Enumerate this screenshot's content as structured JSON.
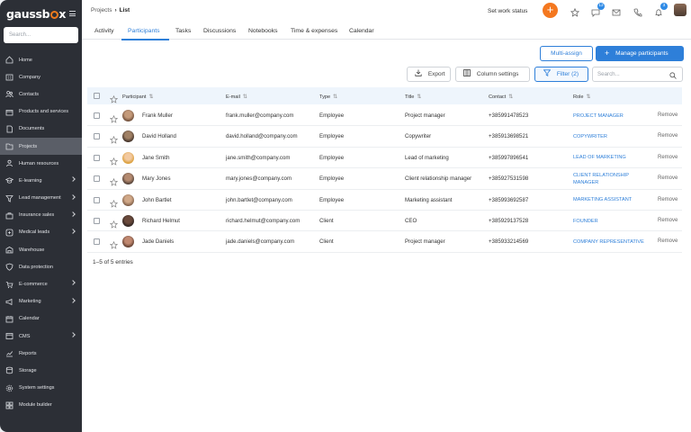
{
  "app": {
    "logo": "gaussbox"
  },
  "sidebar": {
    "search_placeholder": "Search...",
    "items": [
      {
        "label": "Home",
        "icon": "home-icon"
      },
      {
        "label": "Company",
        "icon": "building-icon"
      },
      {
        "label": "Contacts",
        "icon": "contacts-icon"
      },
      {
        "label": "Products and services",
        "icon": "box-icon"
      },
      {
        "label": "Documents",
        "icon": "document-icon"
      },
      {
        "label": "Projects",
        "icon": "folder-icon"
      },
      {
        "label": "Human resources",
        "icon": "people-icon"
      },
      {
        "label": "E-learning",
        "icon": "graduation-icon"
      },
      {
        "label": "Lead management",
        "icon": "funnel-icon"
      },
      {
        "label": "Insurance sales",
        "icon": "briefcase-icon"
      },
      {
        "label": "Medical leads",
        "icon": "medical-icon"
      },
      {
        "label": "Warehouse",
        "icon": "warehouse-icon"
      },
      {
        "label": "Data protection",
        "icon": "shield-icon"
      },
      {
        "label": "E-commerce",
        "icon": "cart-icon"
      },
      {
        "label": "Marketing",
        "icon": "megaphone-icon"
      },
      {
        "label": "Calendar",
        "icon": "calendar-icon"
      },
      {
        "label": "CMS",
        "icon": "cms-icon"
      },
      {
        "label": "Reports",
        "icon": "chart-icon"
      },
      {
        "label": "Storage",
        "icon": "storage-icon"
      },
      {
        "label": "System settings",
        "icon": "gear-icon"
      },
      {
        "label": "Module builder",
        "icon": "module-icon"
      }
    ]
  },
  "header": {
    "breadcrumb_parent": "Projects",
    "breadcrumb_current": "List",
    "set_status": "Set work status",
    "chat_badge": "12",
    "notif_badge": "3"
  },
  "tabs": [
    "Activity",
    "Participants",
    "Tasks",
    "Discussions",
    "Notebooks",
    "Time & expenses",
    "Calendar"
  ],
  "actions": {
    "multi_assign": "Multi-assign",
    "manage": "Manage participants",
    "export": "Export",
    "column_settings": "Column settings",
    "filter": "Filter (2)",
    "search_placeholder": "Search..."
  },
  "table": {
    "columns": [
      "Participant",
      "E-mail",
      "Type",
      "Title",
      "Contact",
      "Role"
    ],
    "rows": [
      {
        "name": "Frank Muller",
        "email": "frank.muller@company.com",
        "type": "Employee",
        "title": "Project manager",
        "contact": "+385991478523",
        "role": "PROJECT MANAGER",
        "action": "Remove"
      },
      {
        "name": "David Holland",
        "email": "david.holland@company.com",
        "type": "Employee",
        "title": "Copywriter",
        "contact": "+385913698521",
        "role": "COPYWRITER",
        "action": "Remove"
      },
      {
        "name": "Jane Smith",
        "email": "jane.smith@company.com",
        "type": "Employee",
        "title": "Lead of marketing",
        "contact": "+385997896541",
        "role": "LEAD OF MARKETING",
        "action": "Remove"
      },
      {
        "name": "Mary Jones",
        "email": "mary.jones@company.com",
        "type": "Employee",
        "title": "Client relationship manager",
        "contact": "+385927531598",
        "role_line1": "CLIENT RELATIONSHIP",
        "role_line2": "MANAGER",
        "action": "Remove"
      },
      {
        "name": "John Bartlet",
        "email": "john.bartlet@company.com",
        "type": "Employee",
        "title": "Marketing assistant",
        "contact": "+385993692587",
        "role": "MARKETING ASSISTANT",
        "action": "Remove"
      },
      {
        "name": "Richard Helmut",
        "email": "richard.helmut@company.com",
        "type": "Client",
        "title": "CEO",
        "contact": "+385929137528",
        "role": "FOUNDER",
        "action": "Remove"
      },
      {
        "name": "Jade Daniels",
        "email": "jade.daniels@company.com",
        "type": "Client",
        "title": "Project manager",
        "contact": "+385933214569",
        "role": "COMPANY REPRESENTATIVE",
        "action": "Remove"
      }
    ],
    "footer": "1–5 of 5 entries"
  },
  "colors": {
    "accent": "#2e7fd9",
    "orange": "#f47820",
    "sidebar": "#2c2f36"
  }
}
